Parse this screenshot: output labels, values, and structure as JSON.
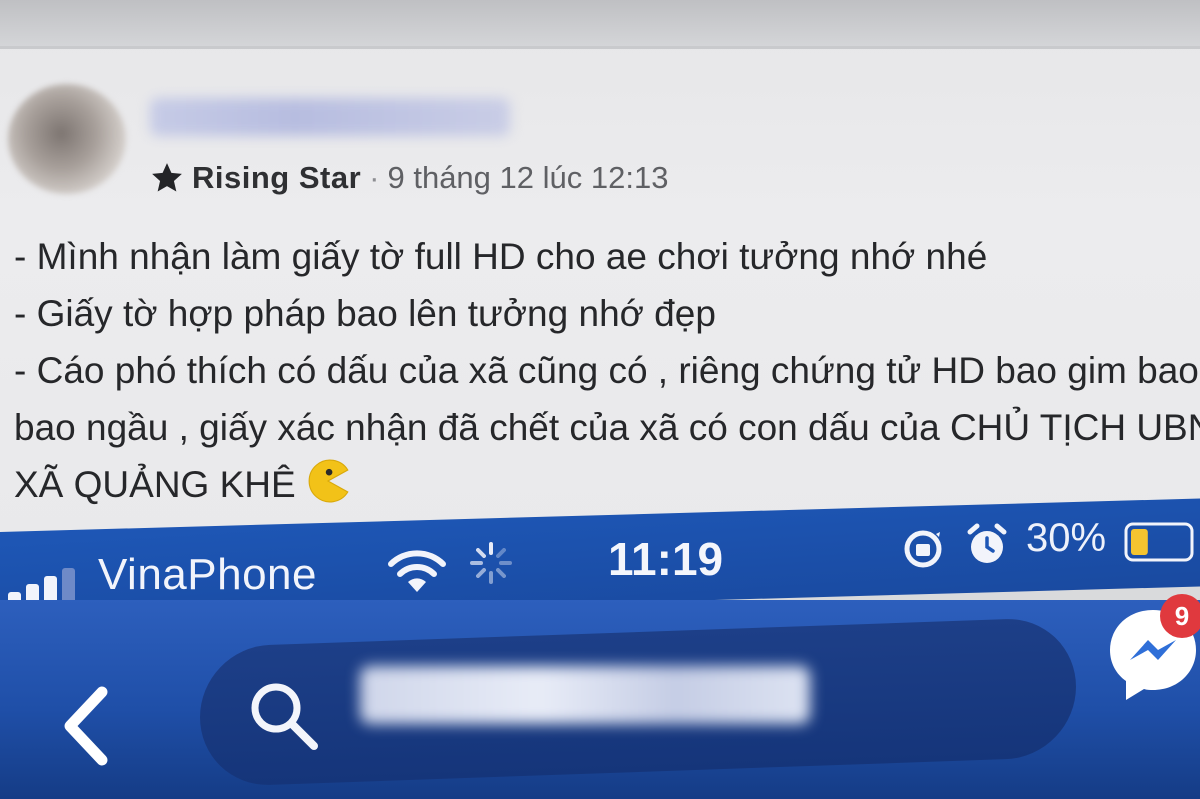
{
  "post": {
    "author_badge": "Rising Star",
    "separator": "·",
    "timestamp": "9 tháng 12 lúc 12:13",
    "lines": [
      "- Mình nhận làm giấy tờ full HD cho ae chơi tưởng nhớ nhé",
      "- Giấy tờ hợp pháp bao lên tưởng nhớ đẹp",
      "- Cáo phó thích có dấu của xã cũng có , riêng chứng tử HD bao gim bao đẹ",
      "bao ngầu , giấy xác nhận đã chết của xã có con dấu của CHỦ TỊCH UBND",
      "XÃ QUẢNG KHÊ"
    ],
    "emoji": "pacman-emoji"
  },
  "status_bar": {
    "carrier": "VinaPhone",
    "time": "11:19",
    "battery": "30%",
    "battery_level": 0.3,
    "icons": [
      "signal-icon",
      "wifi-icon",
      "activity-spinner-icon",
      "orientation-lock-icon",
      "alarm-icon",
      "battery-icon"
    ]
  },
  "nav": {
    "back_icon": "chevron-left-icon",
    "search_icon": "search-icon",
    "search_value": "",
    "messenger_icon": "messenger-icon",
    "messenger_badge": "9"
  },
  "colors": {
    "nav_blue": "#1f4fa8",
    "badge_red": "#e0393e",
    "battery_yellow": "#f4c430"
  }
}
